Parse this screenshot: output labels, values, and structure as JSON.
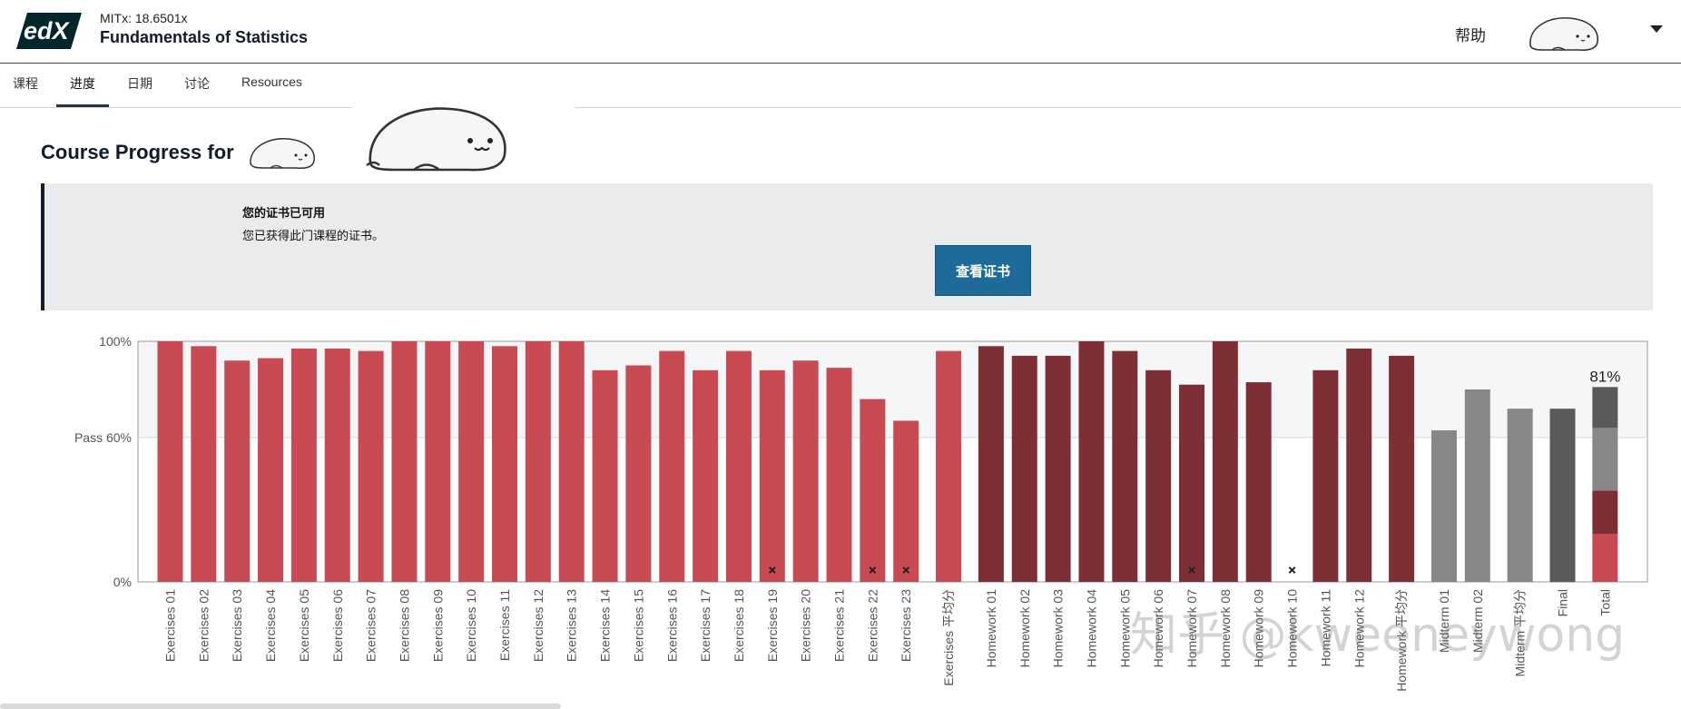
{
  "header": {
    "logo_text": "edX",
    "course_code": "MITx: 18.6501x",
    "course_title": "Fundamentals of Statistics",
    "help": "帮助"
  },
  "tabs": [
    {
      "label": "课程",
      "active": false
    },
    {
      "label": "进度",
      "active": true
    },
    {
      "label": "日期",
      "active": false
    },
    {
      "label": "讨论",
      "active": false
    },
    {
      "label": "Resources",
      "active": false
    }
  ],
  "progress": {
    "title": "Course Progress for"
  },
  "certificate": {
    "heading": "您的证书已可用",
    "body": "您已获得此门课程的证书。",
    "button_label": "查看证书"
  },
  "colors": {
    "exercise": "#c84b53",
    "homework": "#7e2e35",
    "midterm": "#878787",
    "final": "#5a5a5a",
    "accent_button": "#1e6b99"
  },
  "watermark": "知乎 @kweeneywong",
  "chart_data": {
    "type": "bar",
    "ylim": [
      0,
      100
    ],
    "y_ticks": [
      {
        "value": 0,
        "label": "0%"
      },
      {
        "value": 60,
        "label": "Pass 60%"
      },
      {
        "value": 100,
        "label": "100%"
      }
    ],
    "total_label": "81%",
    "bars": [
      {
        "label": "Exercises 01",
        "value": 100,
        "group": "exercise"
      },
      {
        "label": "Exercises 02",
        "value": 98,
        "group": "exercise"
      },
      {
        "label": "Exercises 03",
        "value": 92,
        "group": "exercise"
      },
      {
        "label": "Exercises 04",
        "value": 93,
        "group": "exercise"
      },
      {
        "label": "Exercises 05",
        "value": 97,
        "group": "exercise"
      },
      {
        "label": "Exercises 06",
        "value": 97,
        "group": "exercise"
      },
      {
        "label": "Exercises 07",
        "value": 96,
        "group": "exercise"
      },
      {
        "label": "Exercises 08",
        "value": 100,
        "group": "exercise"
      },
      {
        "label": "Exercises 09",
        "value": 100,
        "group": "exercise"
      },
      {
        "label": "Exercises 10",
        "value": 100,
        "group": "exercise"
      },
      {
        "label": "Exercises 11",
        "value": 98,
        "group": "exercise"
      },
      {
        "label": "Exercises 12",
        "value": 100,
        "group": "exercise"
      },
      {
        "label": "Exercises 13",
        "value": 100,
        "group": "exercise"
      },
      {
        "label": "Exercises 14",
        "value": 88,
        "group": "exercise"
      },
      {
        "label": "Exercises 15",
        "value": 90,
        "group": "exercise"
      },
      {
        "label": "Exercises 16",
        "value": 96,
        "group": "exercise"
      },
      {
        "label": "Exercises 17",
        "value": 88,
        "group": "exercise"
      },
      {
        "label": "Exercises 18",
        "value": 96,
        "group": "exercise"
      },
      {
        "label": "Exercises 19",
        "value": 88,
        "group": "exercise",
        "dropped": true
      },
      {
        "label": "Exercises 20",
        "value": 92,
        "group": "exercise"
      },
      {
        "label": "Exercises 21",
        "value": 89,
        "group": "exercise"
      },
      {
        "label": "Exercises 22",
        "value": 76,
        "group": "exercise",
        "dropped": true
      },
      {
        "label": "Exercises 23",
        "value": 67,
        "group": "exercise",
        "dropped": true
      },
      {
        "label": "Exercises 平均分",
        "value": 96,
        "group": "exercise",
        "gap_before": true
      },
      {
        "label": "Homework 01",
        "value": 98,
        "group": "homework",
        "gap_before": true
      },
      {
        "label": "Homework 02",
        "value": 94,
        "group": "homework"
      },
      {
        "label": "Homework 03",
        "value": 94,
        "group": "homework"
      },
      {
        "label": "Homework 04",
        "value": 100,
        "group": "homework"
      },
      {
        "label": "Homework 05",
        "value": 96,
        "group": "homework"
      },
      {
        "label": "Homework 06",
        "value": 88,
        "group": "homework"
      },
      {
        "label": "Homework 07",
        "value": 82,
        "group": "homework",
        "dropped": true
      },
      {
        "label": "Homework 08",
        "value": 100,
        "group": "homework"
      },
      {
        "label": "Homework 09",
        "value": 83,
        "group": "homework"
      },
      {
        "label": "Homework 10",
        "value": 0,
        "group": "homework",
        "dropped": true
      },
      {
        "label": "Homework 11",
        "value": 88,
        "group": "homework"
      },
      {
        "label": "Homework 12",
        "value": 97,
        "group": "homework"
      },
      {
        "label": "Homework 平均分",
        "value": 94,
        "group": "homework",
        "gap_before": true
      },
      {
        "label": "Midterm 01",
        "value": 63,
        "group": "midterm",
        "gap_before": true
      },
      {
        "label": "Midterm 02",
        "value": 80,
        "group": "midterm"
      },
      {
        "label": "Midterm 平均分",
        "value": 72,
        "group": "midterm",
        "gap_before": true
      },
      {
        "label": "Final",
        "value": 72,
        "group": "final",
        "gap_before": true
      }
    ],
    "total": {
      "label": "Total",
      "value": 81,
      "segments": [
        {
          "group": "exercise",
          "value": 20
        },
        {
          "group": "homework",
          "value": 18
        },
        {
          "group": "midterm",
          "value": 26
        },
        {
          "group": "final",
          "value": 17
        }
      ]
    }
  }
}
